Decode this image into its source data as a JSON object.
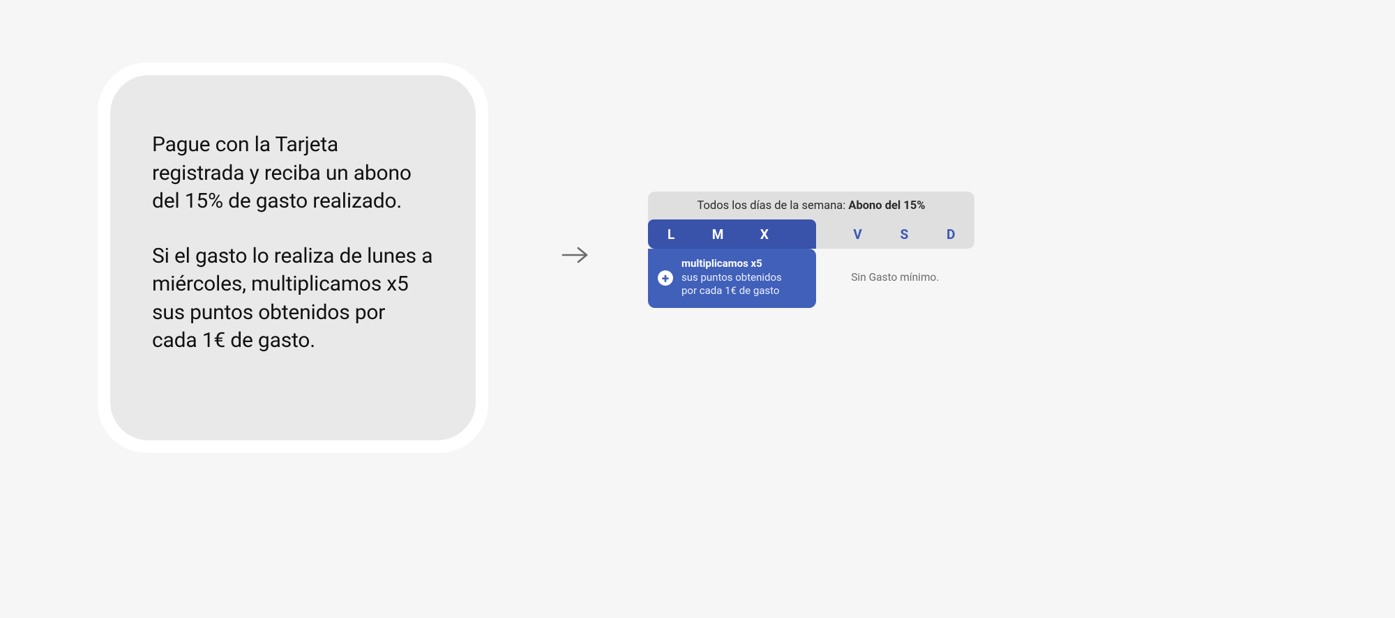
{
  "card": {
    "paragraph1": "Pague con la Tarjeta registrada y reciba un abono del 15% de gasto realizado.",
    "paragraph2": "Si el gasto lo realiza de lunes a miércoles, multiplicamos x5 sus puntos obtenidos por cada 1€ de gasto."
  },
  "arrow": {
    "glyph": "→"
  },
  "widget": {
    "caption_prefix": "Todos los días de la semana: ",
    "caption_strong": "Abono del 15%",
    "days": [
      "L",
      "M",
      "X",
      "",
      "V",
      "S",
      "D"
    ],
    "highlighted_days": [
      0,
      1,
      2,
      3
    ],
    "bonus": {
      "title": "multiplicamos x5",
      "line2": "sus puntos obtenidos",
      "line3": "por cada 1€ de gasto"
    },
    "footnote": "Sin Gasto mínimo."
  }
}
